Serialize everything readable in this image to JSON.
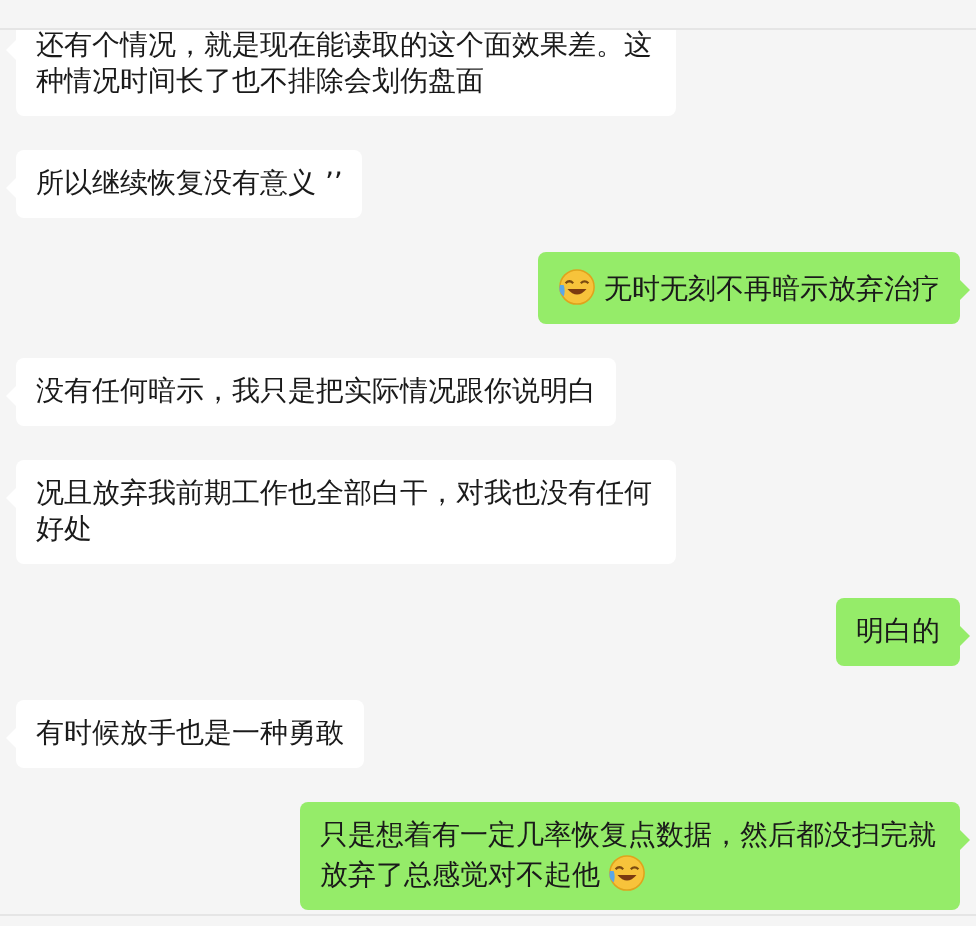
{
  "messages": [
    {
      "outgoing": false,
      "text": "还有个情况，就是现在能读取的这个面效果差。这种情况时间长了也不排除会划伤盘面"
    },
    {
      "outgoing": false,
      "text": "所以继续恢复没有意义  ’’"
    },
    {
      "outgoing": true,
      "text": "无时无刻不再暗示放弃治疗",
      "emoji_before": true
    },
    {
      "outgoing": false,
      "text": "没有任何暗示，我只是把实际情况跟你说明白"
    },
    {
      "outgoing": false,
      "text": "况且放弃我前期工作也全部白干，对我也没有任何好处"
    },
    {
      "outgoing": true,
      "text": "明白的"
    },
    {
      "outgoing": false,
      "text": "有时候放手也是一种勇敢"
    },
    {
      "outgoing": true,
      "text": "只是想着有一定几率恢复点数据，然后都没扫完就放弃了总感觉对不起他",
      "emoji_after": true
    }
  ]
}
